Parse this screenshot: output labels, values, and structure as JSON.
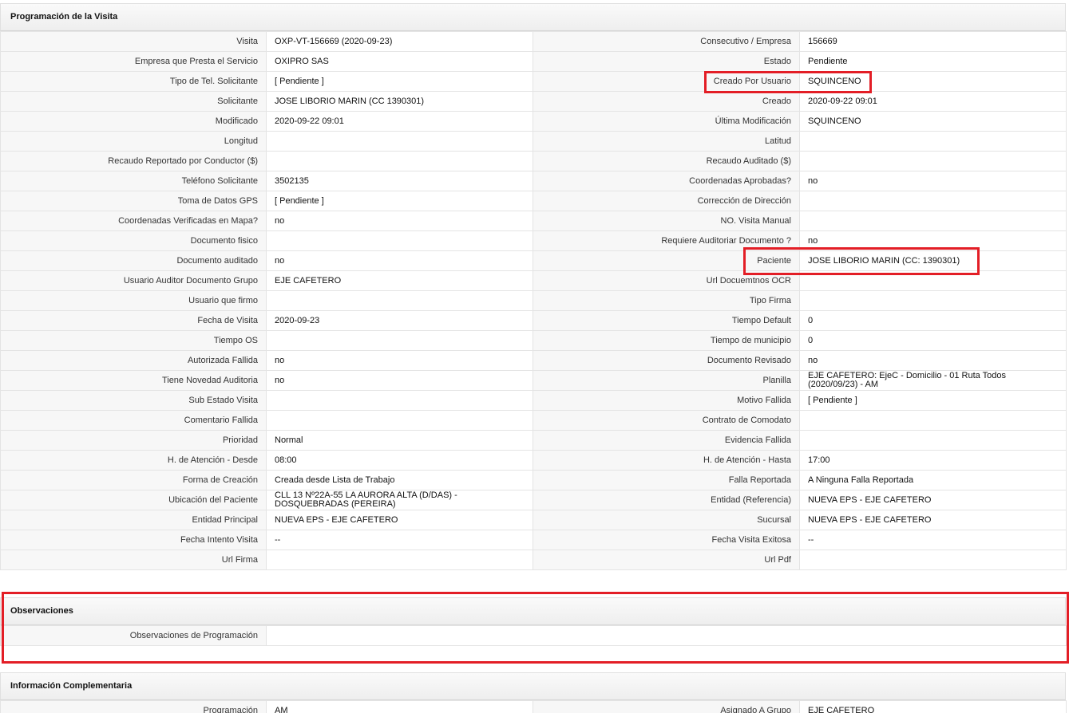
{
  "sections": {
    "programacion_title": "Programación de la Visita",
    "observaciones_title": "Observaciones",
    "complementaria_title": "Información Complementaria"
  },
  "rows": [
    {
      "l1": "Visita",
      "v1": "OXP-VT-156669 (2020-09-23)",
      "l2": "Consecutivo / Empresa",
      "v2": "156669"
    },
    {
      "l1": "Empresa que Presta el Servicio",
      "v1": "OXIPRO SAS",
      "l2": "Estado",
      "v2": "Pendiente"
    },
    {
      "l1": "Tipo de Tel. Solicitante",
      "v1": "[ Pendiente ]",
      "l2": "Creado Por Usuario",
      "v2": "SQUINCENO"
    },
    {
      "l1": "Solicitante",
      "v1": "JOSE LIBORIO MARIN (CC 1390301)",
      "l2": "Creado",
      "v2": "2020-09-22 09:01"
    },
    {
      "l1": "Modificado",
      "v1": "2020-09-22 09:01",
      "l2": "Última Modificación",
      "v2": " SQUINCENO"
    },
    {
      "l1": "Longitud",
      "v1": "",
      "l2": "Latitud",
      "v2": ""
    },
    {
      "l1": "Recaudo Reportado por Conductor ($)",
      "v1": "",
      "l2": "Recaudo Auditado ($)",
      "v2": ""
    },
    {
      "l1": "Teléfono Solicitante",
      "v1": "3502135",
      "l2": "Coordenadas Aprobadas?",
      "v2": " no"
    },
    {
      "l1": "Toma de Datos GPS",
      "v1": "[ Pendiente ]",
      "l2": "Corrección de Dirección",
      "v2": ""
    },
    {
      "l1": "Coordenadas Verificadas en Mapa?",
      "v1": " no",
      "l2": "NO. Visita Manual",
      "v2": ""
    },
    {
      "l1": "Documento fisico",
      "v1": "",
      "l2": "Requiere Auditoriar Documento ?",
      "v2": " no"
    },
    {
      "l1": "Documento auditado",
      "v1": " no",
      "l2": "Paciente",
      "v2": "JOSE LIBORIO MARIN (CC: 1390301)"
    },
    {
      "l1": "Usuario Auditor Documento Grupo",
      "v1": "EJE CAFETERO",
      "l2": "Url Docuemtnos OCR",
      "v2": ""
    },
    {
      "l1": "Usuario que firmo",
      "v1": "",
      "l2": "Tipo Firma",
      "v2": ""
    },
    {
      "l1": "Fecha de Visita",
      "v1": " 2020-09-23",
      "l2": "Tiempo Default",
      "v2": "0"
    },
    {
      "l1": "Tiempo OS",
      "v1": "",
      "l2": "Tiempo de municipio",
      "v2": "0"
    },
    {
      "l1": "Autorizada Fallida",
      "v1": " no",
      "l2": "Documento Revisado",
      "v2": " no"
    },
    {
      "l1": "Tiene Novedad Auditoria",
      "v1": " no",
      "l2": "Planilla",
      "v2": "EJE CAFETERO: EjeC - Domicilio - 01 Ruta Todos (2020/09/23) - AM"
    },
    {
      "l1": "Sub Estado Visita",
      "v1": "",
      "l2": "Motivo Fallida",
      "v2": "[ Pendiente ]"
    },
    {
      "l1": "Comentario Fallida",
      "v1": "",
      "l2": "Contrato de Comodato",
      "v2": ""
    },
    {
      "l1": "Prioridad",
      "v1": "Normal",
      "l2": "Evidencia Fallida",
      "v2": ""
    },
    {
      "l1": "H. de Atención - Desde",
      "v1": "08:00",
      "l2": "H. de Atención - Hasta",
      "v2": "17:00"
    },
    {
      "l1": "Forma de Creación",
      "v1": "Creada desde Lista de Trabajo",
      "l2": "Falla Reportada",
      "v2": "A Ninguna Falla Reportada"
    },
    {
      "l1": "Ubicación del Paciente",
      "v1": "CLL 13 Nº22A-55 LA AURORA ALTA (D/DAS) - DOSQUEBRADAS (PEREIRA)",
      "l2": "Entidad (Referencia)",
      "v2": "NUEVA EPS - EJE CAFETERO"
    },
    {
      "l1": "Entidad Principal",
      "v1": "NUEVA EPS - EJE CAFETERO",
      "l2": "Sucursal",
      "v2": "NUEVA EPS - EJE CAFETERO"
    },
    {
      "l1": "Fecha Intento Visita",
      "v1": " --",
      "l2": "Fecha Visita Exitosa",
      "v2": " --"
    },
    {
      "l1": "Url Firma",
      "v1": "",
      "l2": "Url Pdf",
      "v2": ""
    }
  ],
  "observaciones": {
    "label": "Observaciones de Programación",
    "value": ""
  },
  "complementaria": [
    {
      "l1": "Programación",
      "v1": "AM",
      "l2": "Asignado A Grupo",
      "v2": "EJE CAFETERO"
    }
  ],
  "colors": {
    "highlight": "#e31e26",
    "label_bg": "#f7f7f7",
    "border": "#e4e4e4"
  }
}
